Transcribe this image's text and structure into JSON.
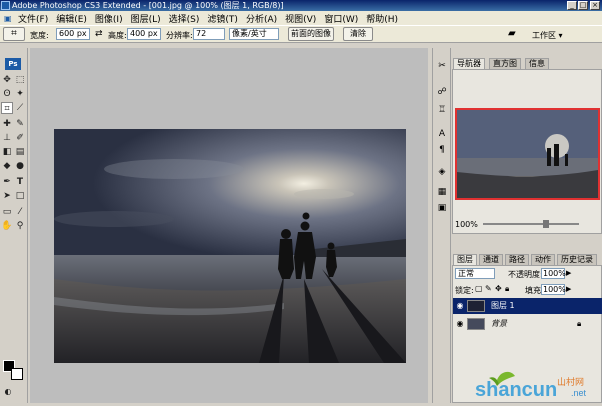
{
  "window": {
    "title": "Adobe Photoshop CS3 Extended - [001.jpg @ 100% (图层 1, RGB/8)]",
    "controls": [
      "_",
      "□",
      "×"
    ]
  },
  "menu": [
    "文件(F)",
    "编辑(E)",
    "图像(I)",
    "图层(L)",
    "选择(S)",
    "滤镜(T)",
    "分析(A)",
    "视图(V)",
    "窗口(W)",
    "帮助(H)"
  ],
  "options_bar": {
    "width_label": "宽度:",
    "width_value": "600 px",
    "swap_icon": "⇄",
    "height_label": "高度:",
    "height_value": "400 px",
    "resolution_label": "分辨率:",
    "resolution_value": "72",
    "unit_value": "像素/英寸",
    "front_image_button": "前面的图像",
    "clear_button": "清除",
    "workspace_label": "工作区 ▾"
  },
  "navigator_panel": {
    "tabs": [
      "导航器",
      "直方图",
      "信息"
    ],
    "zoom": "100%"
  },
  "layers_panel": {
    "tabs": [
      "图层",
      "通道",
      "路径",
      "动作",
      "历史记录"
    ],
    "blend_mode": "正常",
    "opacity_label": "不透明度:",
    "opacity_value": "100%",
    "lock_label": "锁定:",
    "fill_label": "填充:",
    "fill_value": "100%",
    "layers": [
      {
        "name": "图层 1",
        "selected": true
      },
      {
        "name": "背景",
        "selected": false
      }
    ]
  },
  "colors": {
    "titlebar": "#0a246a",
    "selected_layer": "#0a246a",
    "canvas_bg": "#bdbdbd"
  },
  "watermark": {
    "text": "shancun",
    "suffix": ".net",
    "chinese": "山村网"
  }
}
